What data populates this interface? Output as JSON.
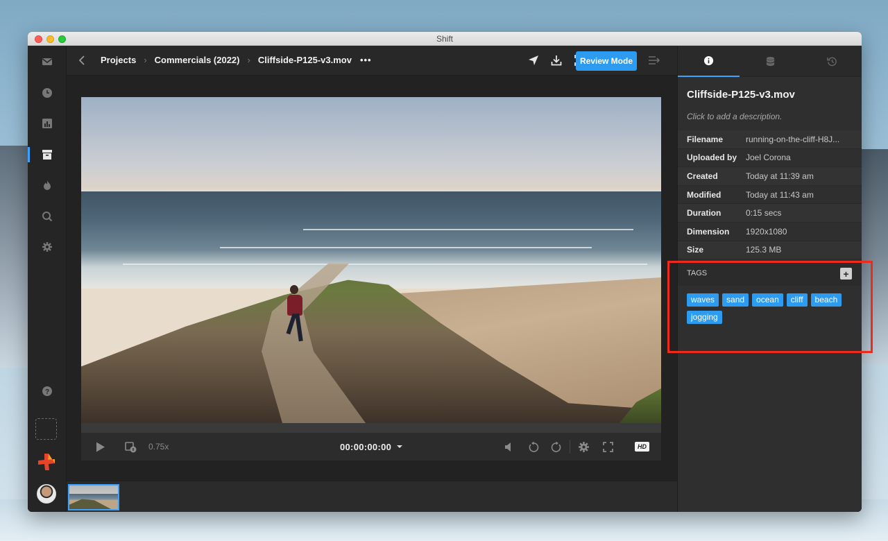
{
  "window": {
    "title": "Shift"
  },
  "breadcrumb": {
    "items": [
      "Projects",
      "Commercials (2022)",
      "Cliffside-P125-v3.mov"
    ],
    "more": "•••"
  },
  "toolbar": {
    "review_label": "Review Mode"
  },
  "player": {
    "speed": "0.75x",
    "timecode": "00:00:00:00",
    "quality_badge": "HD",
    "progress": 0
  },
  "info": {
    "title": "Cliffside-P125-v3.mov",
    "description": "Click to add a description.",
    "meta": [
      {
        "key": "Filename",
        "value": "running-on-the-cliff-H8J..."
      },
      {
        "key": "Uploaded by",
        "value": "Joel Corona"
      },
      {
        "key": "Created",
        "value": "Today at 11:39 am"
      },
      {
        "key": "Modified",
        "value": "Today at 11:43 am"
      },
      {
        "key": "Duration",
        "value": "0:15 secs"
      },
      {
        "key": "Dimension",
        "value": "1920x1080"
      },
      {
        "key": "Size",
        "value": "125.3 MB"
      }
    ],
    "tags_title": "TAGS",
    "tags_add": "+",
    "tags": [
      "waves",
      "sand",
      "ocean",
      "cliff",
      "beach",
      "jogging"
    ]
  },
  "colors": {
    "accent": "#2d9cf0",
    "highlight": "#ee2a1a",
    "logo_red": "#e8442a",
    "logo_orange": "#f79a2a"
  },
  "icons": {
    "sidebar": [
      "inbox-icon",
      "clock-icon",
      "chart-icon",
      "archive-icon",
      "flame-icon",
      "search-icon",
      "gear-icon",
      "help-icon"
    ],
    "toolbar": [
      "send-icon",
      "download-icon",
      "focus-icon",
      "panel-toggle-icon"
    ],
    "info_tabs": [
      "info-icon",
      "database-icon",
      "history-icon"
    ]
  }
}
